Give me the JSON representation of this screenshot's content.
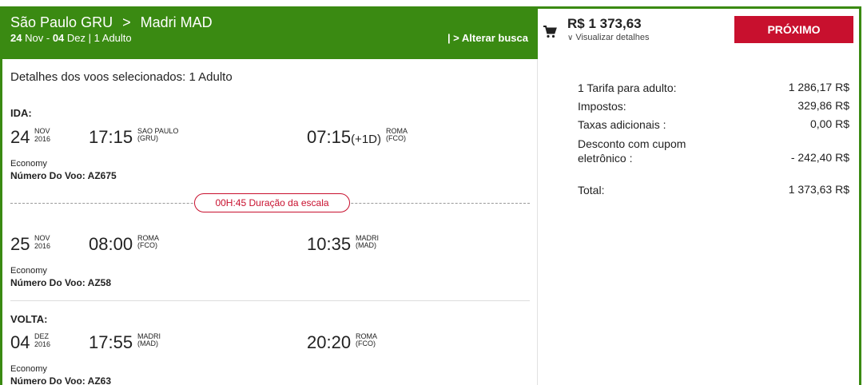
{
  "header": {
    "origin": "São Paulo GRU",
    "separator": ">",
    "destination": "Madri MAD",
    "date_from": "24",
    "month_from": "Nov",
    "dash": "-",
    "date_to": "04",
    "month_to": "Dez",
    "passengers": "| 1 Adulto",
    "alterar_busca": "| > Alterar busca"
  },
  "cart": {
    "total": "R$ 1 373,63",
    "visualizar": "Visualizar detalhes",
    "proximo": "PRÓXIMO"
  },
  "flights": {
    "title": "Detalhes dos voos selecionados: 1 Adulto",
    "ida_label": "IDA:",
    "volta_label": "VOLTA:",
    "layover": "00H:45 Duração da escala",
    "segments": [
      {
        "day": "24",
        "month": "NOV",
        "year": "2016",
        "dep_time": "17:15",
        "dep_city": "SAO PAULO",
        "dep_code": "(GRU)",
        "arr_time": "07:15",
        "arr_plus": "(+1D)",
        "arr_city": "ROMA",
        "arr_code": "(FCO)",
        "class": "Economy",
        "flight": "Número Do Voo: AZ675"
      },
      {
        "day": "25",
        "month": "NOV",
        "year": "2016",
        "dep_time": "08:00",
        "dep_city": "ROMA",
        "dep_code": "(FCO)",
        "arr_time": "10:35",
        "arr_plus": "",
        "arr_city": "MADRI",
        "arr_code": "(MAD)",
        "class": "Economy",
        "flight": "Número Do Voo: AZ58"
      },
      {
        "day": "04",
        "month": "DEZ",
        "year": "2016",
        "dep_time": "17:55",
        "dep_city": "MADRI",
        "dep_code": "(MAD)",
        "arr_time": "20:20",
        "arr_plus": "",
        "arr_city": "ROMA",
        "arr_code": "(FCO)",
        "class": "Economy",
        "flight": "Número Do Voo: AZ63"
      }
    ]
  },
  "summary": {
    "items": [
      {
        "label": "1 Tarifa para adulto:",
        "value": "1 286,17 R$"
      },
      {
        "label": "Impostos:",
        "value": "329,86 R$"
      },
      {
        "label": "Taxas adicionais :",
        "value": "0,00 R$"
      },
      {
        "label": "Desconto com cupom eletrônico :",
        "value": "- 242,40 R$"
      },
      {
        "label": "Total:",
        "value": "1 373,63 R$"
      }
    ]
  },
  "colors": {
    "brand_green": "#3a8a12",
    "accent_red": "#c8102e"
  },
  "icons": {
    "cart": "cart-icon",
    "chevron": "chevron-down-icon"
  }
}
